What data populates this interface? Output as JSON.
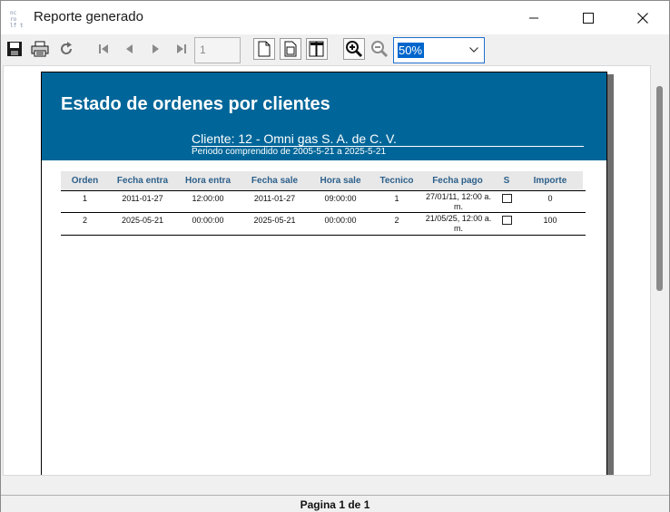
{
  "window": {
    "title": "Reporte generado",
    "app_icon_text": [
      "nc",
      "ro",
      "lf t"
    ]
  },
  "toolbar": {
    "page_number": "1",
    "zoom": "50%",
    "icons": [
      "save-icon",
      "print-icon",
      "refresh-icon",
      "first-page-icon",
      "prev-page-icon",
      "next-page-icon",
      "last-page-icon",
      "page-width-icon",
      "whole-page-icon",
      "two-pages-icon",
      "zoom-in-icon",
      "zoom-out-icon"
    ]
  },
  "report": {
    "title": "Estado de ordenes por clientes",
    "client": "Cliente: 12 - Omni gas S. A. de C. V.",
    "period": "Periodo comprendido de 2005-5-21 a 2025-5-21",
    "columns": [
      "Orden",
      "Fecha entra",
      "Hora entra",
      "Fecha sale",
      "Hora sale",
      "Tecnico",
      "Fecha pago",
      "S",
      "Importe"
    ],
    "rows": [
      {
        "orden": "1",
        "fecha_entra": "2011-01-27",
        "hora_entra": "12:00:00",
        "fecha_sale": "2011-01-27",
        "hora_sale": "09:00:00",
        "tecnico": "1",
        "fecha_pago_1": "27/01/11, 12:00 a.",
        "fecha_pago_2": "m.",
        "s": false,
        "importe": "0"
      },
      {
        "orden": "2",
        "fecha_entra": "2025-05-21",
        "hora_entra": "00:00:00",
        "fecha_sale": "2025-05-21",
        "hora_sale": "00:00:00",
        "tecnico": "2",
        "fecha_pago_1": "21/05/25, 12:00 a.",
        "fecha_pago_2": "m.",
        "s": false,
        "importe": "100"
      }
    ]
  },
  "status": {
    "prefix": "Pagina",
    "current": "1",
    "of": "de",
    "total": "1"
  }
}
